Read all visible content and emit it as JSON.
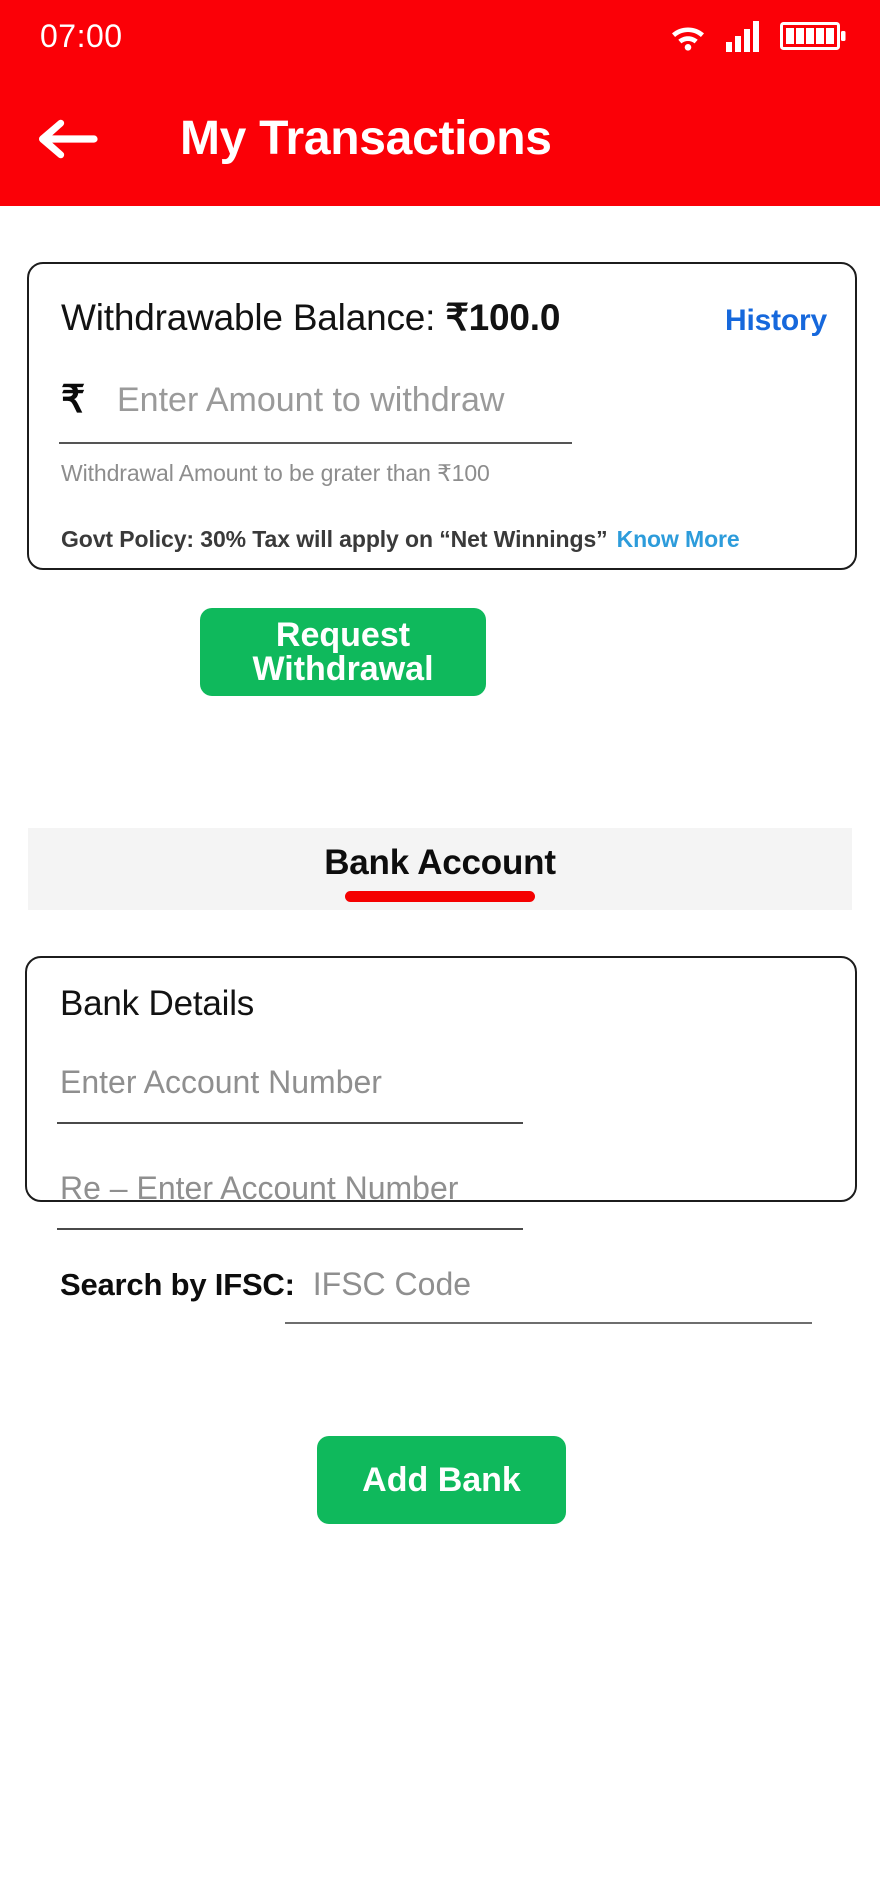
{
  "statusbar": {
    "time": "07:00",
    "icons": {
      "wifi": "wifi-icon",
      "signal": "cellular-signal-icon",
      "battery": "battery-full-icon"
    }
  },
  "appbar": {
    "back_icon": "back-arrow-icon",
    "title": "My Transactions",
    "background_color": "#FB0007"
  },
  "withdraw_card": {
    "balance_label": "Withdrawable Balance: ",
    "balance_value": "₹100.0",
    "history_label": "History",
    "history_color": "#1668DC",
    "currency_symbol": "₹",
    "amount_placeholder": "Enter Amount to withdraw",
    "amount_value": "",
    "helper_text": "Withdrawal Amount to be grater than ₹100",
    "policy_text": "Govt Policy: 30% Tax will apply on  “Net Winnings”",
    "know_more_label": "Know More",
    "know_more_color": "#2D9CDB"
  },
  "actions": {
    "request_withdrawal_label": "Request Withdrawal",
    "add_bank_label": "Add Bank",
    "button_color": "#0FB95C"
  },
  "tabs": {
    "items": [
      {
        "label": "Bank Account",
        "active": true
      }
    ],
    "indicator_color": "#F50000",
    "strip_background": "#F4F4F4"
  },
  "bank_card": {
    "title": "Bank Details",
    "account_placeholder": "Enter Account Number",
    "account_value": "",
    "reaccount_placeholder": "Re – Enter Account Number",
    "reaccount_value": "",
    "ifsc_label": "Search by IFSC:",
    "ifsc_placeholder": "IFSC Code",
    "ifsc_value": ""
  }
}
